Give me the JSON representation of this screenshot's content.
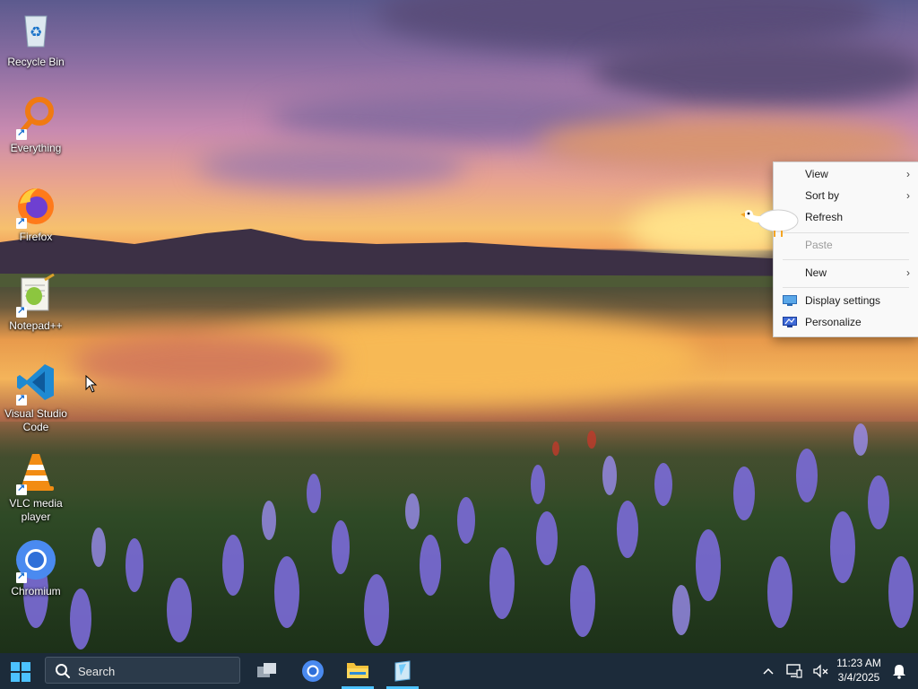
{
  "desktop": {
    "icons": [
      {
        "label": "Recycle Bin",
        "icon": "recycle-bin-icon"
      },
      {
        "label": "Everything",
        "icon": "everything-search-icon"
      },
      {
        "label": "Firefox",
        "icon": "firefox-icon"
      },
      {
        "label": "Notepad++",
        "icon": "notepadpp-icon"
      },
      {
        "label": "Visual Studio Code",
        "icon": "vscode-icon"
      },
      {
        "label": "VLC media player",
        "icon": "vlc-icon"
      },
      {
        "label": "Chromium",
        "icon": "chromium-icon"
      }
    ]
  },
  "context_menu": {
    "view": "View",
    "sort_by": "Sort by",
    "refresh": "Refresh",
    "paste": "Paste",
    "new": "New",
    "display_settings": "Display settings",
    "personalize": "Personalize",
    "submenu_arrow": "›"
  },
  "taskbar": {
    "search_placeholder": "Search",
    "apps": [
      "task-view-icon",
      "chromium-icon",
      "file-explorer-icon",
      "notepad-icon"
    ],
    "tray": {
      "time": "11:23 AM",
      "date": "3/4/2025"
    },
    "accent": "#4cc2ff"
  }
}
